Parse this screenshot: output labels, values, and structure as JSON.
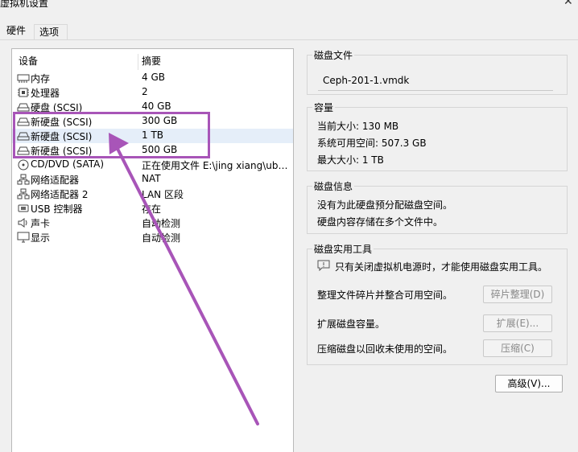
{
  "window": {
    "title": "虚拟机设置"
  },
  "tabs": [
    {
      "label": "硬件",
      "active": true
    },
    {
      "label": "选项",
      "active": false
    }
  ],
  "device_list": {
    "headers": {
      "device": "设备",
      "summary": "摘要"
    },
    "rows": [
      {
        "icon": "memory-icon",
        "name": "内存",
        "summary": "4 GB"
      },
      {
        "icon": "cpu-icon",
        "name": "处理器",
        "summary": "2"
      },
      {
        "icon": "disk-icon",
        "name": "硬盘 (SCSI)",
        "summary": "40 GB"
      },
      {
        "icon": "disk-icon",
        "name": "新硬盘 (SCSI)",
        "summary": "300 GB"
      },
      {
        "icon": "disk-icon",
        "name": "新硬盘 (SCSI)",
        "summary": "1 TB"
      },
      {
        "icon": "disk-icon",
        "name": "新硬盘 (SCSI)",
        "summary": "500 GB"
      },
      {
        "icon": "cd-icon",
        "name": "CD/DVD (SATA)",
        "summary": "正在使用文件 E:\\jing xiang\\ubu..."
      },
      {
        "icon": "network-icon",
        "name": "网络适配器",
        "summary": "NAT"
      },
      {
        "icon": "network-icon",
        "name": "网络适配器 2",
        "summary": "LAN 区段"
      },
      {
        "icon": "usb-icon",
        "name": "USB 控制器",
        "summary": "存在"
      },
      {
        "icon": "speaker-icon",
        "name": "声卡",
        "summary": "自动检测"
      },
      {
        "icon": "monitor-icon",
        "name": "显示",
        "summary": "自动检测"
      }
    ]
  },
  "disk_file": {
    "title": "磁盘文件",
    "value": "Ceph-201-1.vmdk"
  },
  "capacity": {
    "title": "容量",
    "current_size": "当前大小: 130 MB",
    "available": "系统可用空间: 507.3 GB",
    "max_size": "最大大小: 1 TB"
  },
  "disk_info": {
    "title": "磁盘信息",
    "line1": "没有为此硬盘预分配磁盘空间。",
    "line2": "硬盘内容存储在多个文件中。"
  },
  "disk_tools": {
    "title": "磁盘实用工具",
    "notice": "只有关闭虚拟机电源时，才能使用磁盘实用工具。",
    "defrag_text": "整理文件碎片并整合可用空间。",
    "defrag_button": "碎片整理(D)",
    "expand_text": "扩展磁盘容量。",
    "expand_button": "扩展(E)...",
    "compact_text": "压缩磁盘以回收未使用的空间。",
    "compact_button": "压缩(C)"
  },
  "advanced_button": "高级(V)...",
  "colors": {
    "annotation": "#a855b8",
    "list_bg": "#ffffff",
    "window_bg": "#f0f0f0"
  }
}
